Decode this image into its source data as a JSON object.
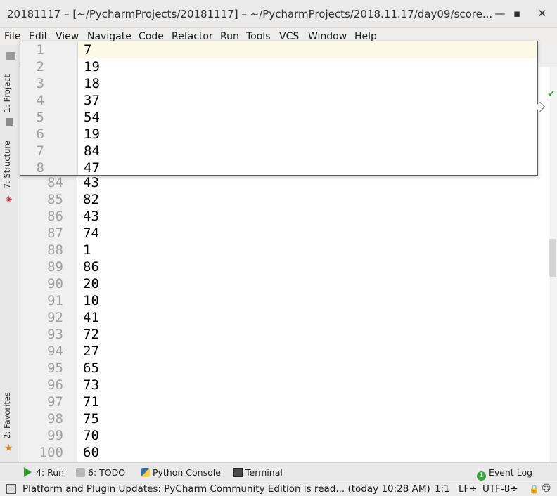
{
  "window": {
    "title": "20181117 – [~/PycharmProjects/20181117] – ~/PycharmProjects/2018.11.17/day09/score...",
    "minimize_icon": "minimize-icon",
    "maximize_icon": "maximize-icon",
    "close_icon": "close-icon"
  },
  "menu": [
    "File",
    "Edit",
    "View",
    "Navigate",
    "Code",
    "Refactor",
    "Run",
    "Tools",
    "VCS",
    "Window",
    "Help"
  ],
  "left_tabs": {
    "project": "1: Project",
    "structure": "7: Structure",
    "favorites": "2: Favorites"
  },
  "popup_lines": [
    {
      "n": "1",
      "v": "7"
    },
    {
      "n": "2",
      "v": "19"
    },
    {
      "n": "3",
      "v": "18"
    },
    {
      "n": "4",
      "v": "37"
    },
    {
      "n": "5",
      "v": "54"
    },
    {
      "n": "6",
      "v": "19"
    },
    {
      "n": "7",
      "v": "84"
    },
    {
      "n": "8",
      "v": "47"
    }
  ],
  "editor_lines": [
    {
      "n": "84",
      "v": "43"
    },
    {
      "n": "85",
      "v": "82"
    },
    {
      "n": "86",
      "v": "43"
    },
    {
      "n": "87",
      "v": "74"
    },
    {
      "n": "88",
      "v": "1"
    },
    {
      "n": "89",
      "v": "86"
    },
    {
      "n": "90",
      "v": "20"
    },
    {
      "n": "91",
      "v": "10"
    },
    {
      "n": "92",
      "v": "41"
    },
    {
      "n": "93",
      "v": "72"
    },
    {
      "n": "94",
      "v": "27"
    },
    {
      "n": "95",
      "v": "65"
    },
    {
      "n": "96",
      "v": "73"
    },
    {
      "n": "97",
      "v": "71"
    },
    {
      "n": "98",
      "v": "75"
    },
    {
      "n": "99",
      "v": "70"
    },
    {
      "n": "100",
      "v": "60"
    }
  ],
  "bottom_tabs": {
    "run": "4: Run",
    "todo": "6: TODO",
    "python_console": "Python Console",
    "terminal": "Terminal",
    "event_log": "Event Log",
    "event_log_count": "1"
  },
  "status": {
    "message": "Platform and Plugin Updates: PyCharm Community Edition is read... (today 10:28 AM)",
    "position": "1:1",
    "line_separator": "LF÷",
    "encoding": "UTF-8÷"
  },
  "colors": {
    "accent_green": "#3aa33a",
    "popup_highlight": "#fcfae6"
  }
}
